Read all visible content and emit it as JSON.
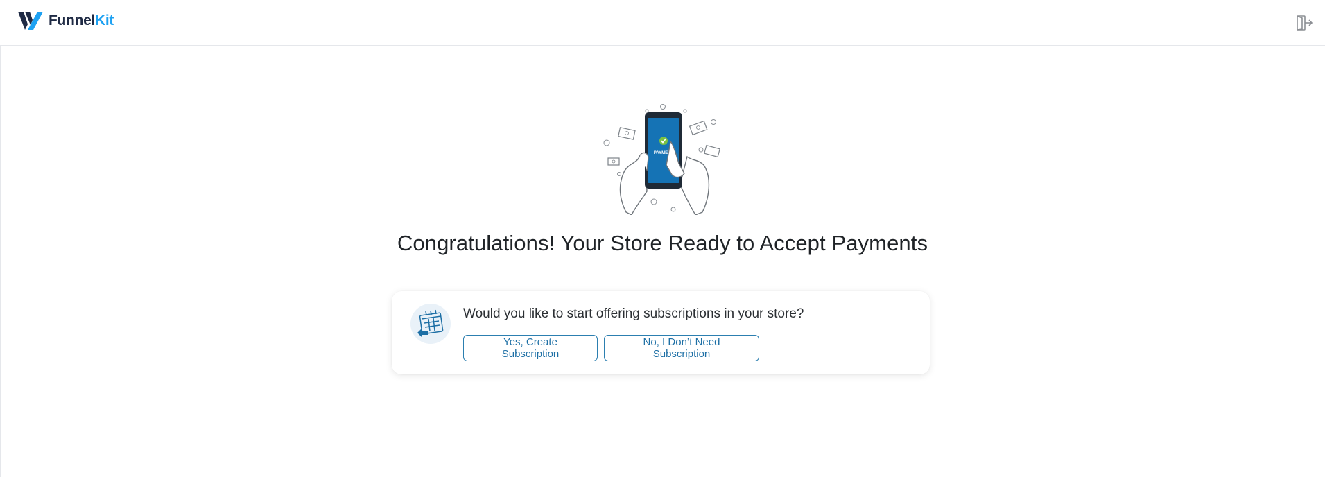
{
  "header": {
    "logo_text_1": "Funnel",
    "logo_text_2": "Kit",
    "exit_icon": "exit-icon"
  },
  "main": {
    "title": "Congratulations! Your Store Ready to Accept Payments",
    "illustration": "payment-phone-illustration",
    "phone_label": "PAYMENT"
  },
  "card": {
    "icon": "calendar-icon",
    "question": "Would you like to start offering subscriptions in your store?",
    "yes_label": "Yes, Create Subscription",
    "no_label": "No, I Don’t Need Subscription"
  },
  "colors": {
    "brand_dark": "#1f2a44",
    "brand_accent": "#1da1f2",
    "button_border": "#2c7fb0",
    "phone_blue": "#1573b5"
  }
}
